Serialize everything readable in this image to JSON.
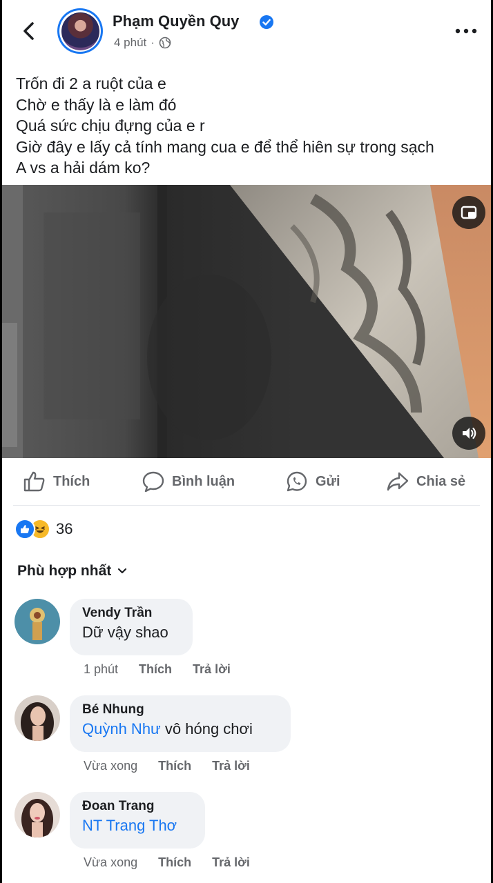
{
  "header": {
    "author": "Phạm Quyền Quy",
    "time": "4 phút",
    "separator": "·"
  },
  "post": {
    "lines": [
      "Trốn đi 2 a ruột của e",
      "Chờ e thấy là e làm đó",
      "Quá sức chịu đựng của e r",
      "Giờ đây e lấy cả tính mang cua e để thể hiên sự trong sạch",
      "A vs a hải dám ko?"
    ]
  },
  "actions": {
    "like": "Thích",
    "comment": "Bình luận",
    "send": "Gửi",
    "share": "Chia sẻ"
  },
  "reactions": {
    "count": "36"
  },
  "sort": {
    "label": "Phù hợp nhất"
  },
  "comments": [
    {
      "author": "Vendy Trần",
      "mention": "",
      "text": "Dữ vậy shao",
      "time": "1 phút",
      "like": "Thích",
      "reply": "Trả lời"
    },
    {
      "author": "Bé Nhung",
      "mention": "Quỳnh Như",
      "text": " vô hóng chơi",
      "time": "Vừa xong",
      "like": "Thích",
      "reply": "Trả lời"
    },
    {
      "author": "Đoan Trang",
      "mention": "NT Trang Thơ",
      "text": "",
      "time": "Vừa xong",
      "like": "Thích",
      "reply": "Trả lời"
    }
  ],
  "colors": {
    "accent": "#1877f2",
    "text": "#1c1e21",
    "muted": "#65676b",
    "bubble": "#f0f2f5"
  }
}
